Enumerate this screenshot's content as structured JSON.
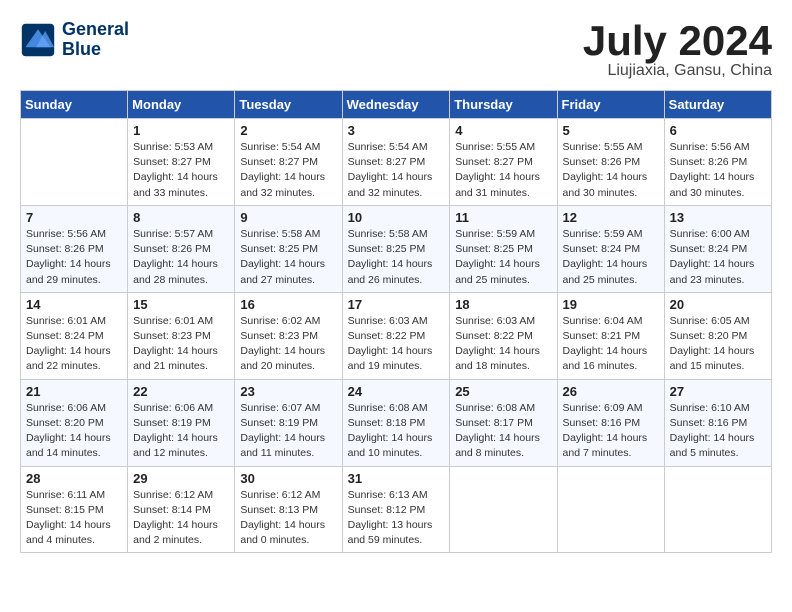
{
  "header": {
    "logo_line1": "General",
    "logo_line2": "Blue",
    "month": "July 2024",
    "location": "Liujiaxia, Gansu, China"
  },
  "weekdays": [
    "Sunday",
    "Monday",
    "Tuesday",
    "Wednesday",
    "Thursday",
    "Friday",
    "Saturday"
  ],
  "weeks": [
    [
      {
        "day": null
      },
      {
        "day": "1",
        "sunrise": "Sunrise: 5:53 AM",
        "sunset": "Sunset: 8:27 PM",
        "daylight": "Daylight: 14 hours and 33 minutes."
      },
      {
        "day": "2",
        "sunrise": "Sunrise: 5:54 AM",
        "sunset": "Sunset: 8:27 PM",
        "daylight": "Daylight: 14 hours and 32 minutes."
      },
      {
        "day": "3",
        "sunrise": "Sunrise: 5:54 AM",
        "sunset": "Sunset: 8:27 PM",
        "daylight": "Daylight: 14 hours and 32 minutes."
      },
      {
        "day": "4",
        "sunrise": "Sunrise: 5:55 AM",
        "sunset": "Sunset: 8:27 PM",
        "daylight": "Daylight: 14 hours and 31 minutes."
      },
      {
        "day": "5",
        "sunrise": "Sunrise: 5:55 AM",
        "sunset": "Sunset: 8:26 PM",
        "daylight": "Daylight: 14 hours and 30 minutes."
      },
      {
        "day": "6",
        "sunrise": "Sunrise: 5:56 AM",
        "sunset": "Sunset: 8:26 PM",
        "daylight": "Daylight: 14 hours and 30 minutes."
      }
    ],
    [
      {
        "day": "7",
        "sunrise": "Sunrise: 5:56 AM",
        "sunset": "Sunset: 8:26 PM",
        "daylight": "Daylight: 14 hours and 29 minutes."
      },
      {
        "day": "8",
        "sunrise": "Sunrise: 5:57 AM",
        "sunset": "Sunset: 8:26 PM",
        "daylight": "Daylight: 14 hours and 28 minutes."
      },
      {
        "day": "9",
        "sunrise": "Sunrise: 5:58 AM",
        "sunset": "Sunset: 8:25 PM",
        "daylight": "Daylight: 14 hours and 27 minutes."
      },
      {
        "day": "10",
        "sunrise": "Sunrise: 5:58 AM",
        "sunset": "Sunset: 8:25 PM",
        "daylight": "Daylight: 14 hours and 26 minutes."
      },
      {
        "day": "11",
        "sunrise": "Sunrise: 5:59 AM",
        "sunset": "Sunset: 8:25 PM",
        "daylight": "Daylight: 14 hours and 25 minutes."
      },
      {
        "day": "12",
        "sunrise": "Sunrise: 5:59 AM",
        "sunset": "Sunset: 8:24 PM",
        "daylight": "Daylight: 14 hours and 25 minutes."
      },
      {
        "day": "13",
        "sunrise": "Sunrise: 6:00 AM",
        "sunset": "Sunset: 8:24 PM",
        "daylight": "Daylight: 14 hours and 23 minutes."
      }
    ],
    [
      {
        "day": "14",
        "sunrise": "Sunrise: 6:01 AM",
        "sunset": "Sunset: 8:24 PM",
        "daylight": "Daylight: 14 hours and 22 minutes."
      },
      {
        "day": "15",
        "sunrise": "Sunrise: 6:01 AM",
        "sunset": "Sunset: 8:23 PM",
        "daylight": "Daylight: 14 hours and 21 minutes."
      },
      {
        "day": "16",
        "sunrise": "Sunrise: 6:02 AM",
        "sunset": "Sunset: 8:23 PM",
        "daylight": "Daylight: 14 hours and 20 minutes."
      },
      {
        "day": "17",
        "sunrise": "Sunrise: 6:03 AM",
        "sunset": "Sunset: 8:22 PM",
        "daylight": "Daylight: 14 hours and 19 minutes."
      },
      {
        "day": "18",
        "sunrise": "Sunrise: 6:03 AM",
        "sunset": "Sunset: 8:22 PM",
        "daylight": "Daylight: 14 hours and 18 minutes."
      },
      {
        "day": "19",
        "sunrise": "Sunrise: 6:04 AM",
        "sunset": "Sunset: 8:21 PM",
        "daylight": "Daylight: 14 hours and 16 minutes."
      },
      {
        "day": "20",
        "sunrise": "Sunrise: 6:05 AM",
        "sunset": "Sunset: 8:20 PM",
        "daylight": "Daylight: 14 hours and 15 minutes."
      }
    ],
    [
      {
        "day": "21",
        "sunrise": "Sunrise: 6:06 AM",
        "sunset": "Sunset: 8:20 PM",
        "daylight": "Daylight: 14 hours and 14 minutes."
      },
      {
        "day": "22",
        "sunrise": "Sunrise: 6:06 AM",
        "sunset": "Sunset: 8:19 PM",
        "daylight": "Daylight: 14 hours and 12 minutes."
      },
      {
        "day": "23",
        "sunrise": "Sunrise: 6:07 AM",
        "sunset": "Sunset: 8:19 PM",
        "daylight": "Daylight: 14 hours and 11 minutes."
      },
      {
        "day": "24",
        "sunrise": "Sunrise: 6:08 AM",
        "sunset": "Sunset: 8:18 PM",
        "daylight": "Daylight: 14 hours and 10 minutes."
      },
      {
        "day": "25",
        "sunrise": "Sunrise: 6:08 AM",
        "sunset": "Sunset: 8:17 PM",
        "daylight": "Daylight: 14 hours and 8 minutes."
      },
      {
        "day": "26",
        "sunrise": "Sunrise: 6:09 AM",
        "sunset": "Sunset: 8:16 PM",
        "daylight": "Daylight: 14 hours and 7 minutes."
      },
      {
        "day": "27",
        "sunrise": "Sunrise: 6:10 AM",
        "sunset": "Sunset: 8:16 PM",
        "daylight": "Daylight: 14 hours and 5 minutes."
      }
    ],
    [
      {
        "day": "28",
        "sunrise": "Sunrise: 6:11 AM",
        "sunset": "Sunset: 8:15 PM",
        "daylight": "Daylight: 14 hours and 4 minutes."
      },
      {
        "day": "29",
        "sunrise": "Sunrise: 6:12 AM",
        "sunset": "Sunset: 8:14 PM",
        "daylight": "Daylight: 14 hours and 2 minutes."
      },
      {
        "day": "30",
        "sunrise": "Sunrise: 6:12 AM",
        "sunset": "Sunset: 8:13 PM",
        "daylight": "Daylight: 14 hours and 0 minutes."
      },
      {
        "day": "31",
        "sunrise": "Sunrise: 6:13 AM",
        "sunset": "Sunset: 8:12 PM",
        "daylight": "Daylight: 13 hours and 59 minutes."
      },
      {
        "day": null
      },
      {
        "day": null
      },
      {
        "day": null
      }
    ]
  ]
}
